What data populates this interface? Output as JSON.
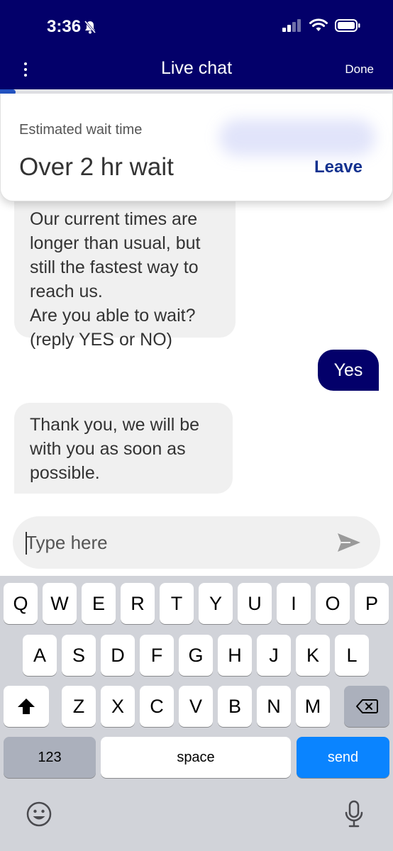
{
  "status": {
    "time": "3:36"
  },
  "header": {
    "title": "Live chat",
    "done_label": "Done",
    "accent": "#03006a"
  },
  "progress": {
    "fraction": 0.04
  },
  "wait": {
    "label": "Estimated wait time",
    "value": "Over 2 hr wait",
    "leave_label": "Leave"
  },
  "messages": [
    {
      "from": "agent",
      "lines": [
        "Our current times are",
        "longer than usual, but",
        "still the fastest way to",
        "reach us.",
        "Are you able to wait?",
        "(reply YES or NO)"
      ]
    },
    {
      "from": "user",
      "text": "Yes"
    },
    {
      "from": "agent",
      "lines": [
        "Thank you, we will be",
        "with you as soon as",
        "possible."
      ]
    }
  ],
  "input": {
    "placeholder": "Type here",
    "send_icon": "send-icon"
  },
  "keyboard": {
    "row1": [
      "Q",
      "W",
      "E",
      "R",
      "T",
      "Y",
      "U",
      "I",
      "O",
      "P"
    ],
    "row2": [
      "A",
      "S",
      "D",
      "F",
      "G",
      "H",
      "J",
      "K",
      "L"
    ],
    "row3": [
      "Z",
      "X",
      "C",
      "V",
      "B",
      "N",
      "M"
    ],
    "numbers_label": "123",
    "space_label": "space",
    "send_label": "send",
    "send_color": "#0a84ff"
  }
}
